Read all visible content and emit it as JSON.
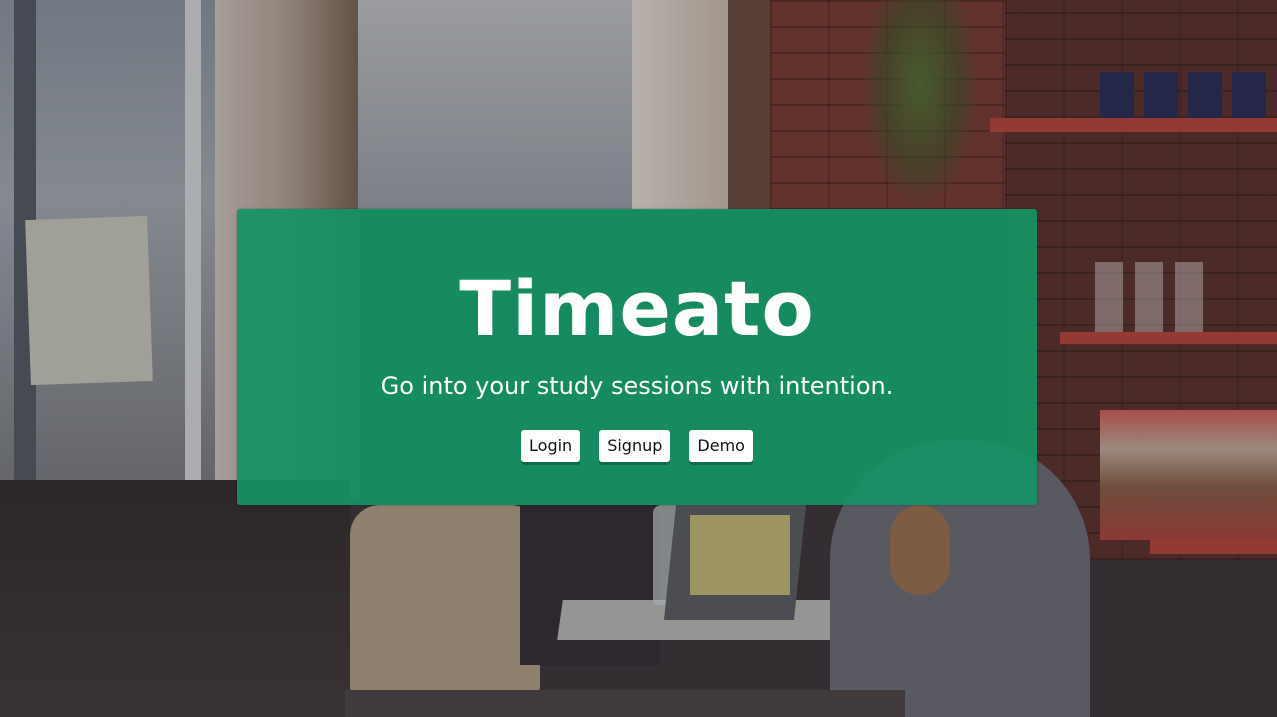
{
  "hero": {
    "title": "Timeato",
    "subtitle": "Go into your study sessions with intention.",
    "buttons": {
      "login": "Login",
      "signup": "Signup",
      "demo": "Demo"
    }
  },
  "colors": {
    "hero_background": "#169264",
    "button_background": "#ffffff",
    "text": "#ffffff"
  }
}
